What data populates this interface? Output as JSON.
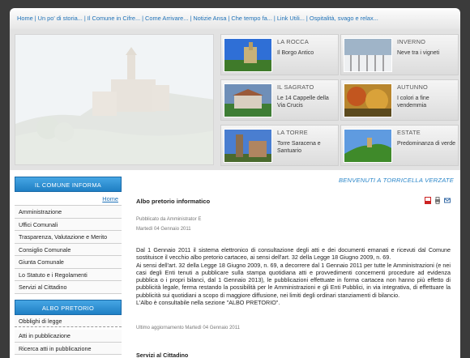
{
  "nav": {
    "items": [
      "Home",
      "Un po' di storia...",
      "Il Comune in Cifre...",
      "Come Arrivare...",
      "Notizie Ansa",
      "Che tempo fa...",
      "Link Utili...",
      "Ospitalità, svago e relax..."
    ],
    "separator": "|"
  },
  "tiles": [
    {
      "title": "LA ROCCA",
      "subtitle": "Il Borgo Antico"
    },
    {
      "title": "INVERNO",
      "subtitle": "Neve tra i vigneti"
    },
    {
      "title": "IL SAGRATO",
      "subtitle": "Le 14 Cappelle della Via Crucis"
    },
    {
      "title": "AUTUNNO",
      "subtitle": "I colori a fine vendemmia"
    },
    {
      "title": "LA TORRE",
      "subtitle": "Torre Saracena e Santuario"
    },
    {
      "title": "ESTATE",
      "subtitle": "Predominanza di verde"
    }
  ],
  "sidebar": {
    "header1": "IL COMUNE INFORMA",
    "home_link": "Home",
    "items1": [
      "Amministrazione",
      "Uffici Comunali",
      "Trasparenza, Valutazione e Merito",
      "Consiglio Comunale",
      "Giunta Comunale",
      "Lo Statuto e i Regolamenti",
      "Servizi al Cittadino"
    ],
    "header2": "ALBO PRETORIO",
    "items2": [
      "Obblighi di legge",
      "Atti in pubblicazione",
      "Ricerca atti in pubblicazione"
    ]
  },
  "content": {
    "welcome": "BENVENUTI A TORRICELLA VERZATE",
    "title": "Albo pretorio informatico",
    "published_by": "Pubblicato da Amministrator E",
    "date": "Martedì 04 Gennaio 2011",
    "paragraphs": [
      "Dal 1 Gennaio 2011 il sistema elettronico di consultazione degli atti e dei documenti emanati e ricevuti dal Comune sostituisce il vecchio albo pretorio cartaceo, ai sensi dell'art. 32 della Legge 18 Giugno 2009, n. 69.",
      "Ai sensi dell'art. 32 della Legge 18 Giugno 2009, n. 69, a decorrere dal 1 Gennaio 2011 per tutte le Amministrazioni (e nei casi degli Enti tenuti a pubblicare sulla stampa quotidiana atti e provvedimenti concernenti procedure ad evidenza pubblica o i propri bilanci, dal 1 Gennaio 2013), le pubblicazioni effettuate in forma cartacea non hanno più effetto di pubblicità legale, ferma restando la possibilità per le Amministrazioni e gli Enti Pubblici, in via integrativa, di effettuare la pubblicità sui quotidiani a scopo di maggiore diffusione, nei limiti degli ordinari stanziamenti di bilancio.",
      "L'Albo è consultabile nella sezione \"ALBO PRETORIO\"."
    ],
    "last_update": "Ultimo aggiornamento Martedì 04 Gennaio 2011",
    "subtitle": "Servizi al Cittadino"
  },
  "icons": [
    "pdf-icon",
    "print-icon",
    "email-icon"
  ]
}
